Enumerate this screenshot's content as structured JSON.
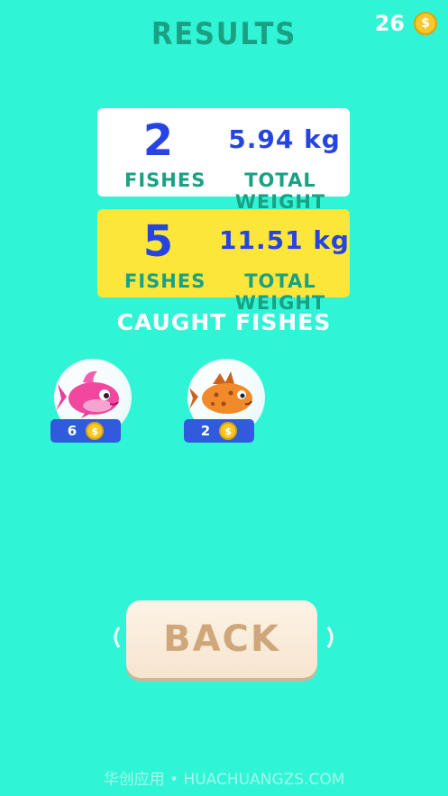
{
  "header": {
    "title": "RESULTS",
    "coin_count": "26"
  },
  "current_result": {
    "fishes": "2",
    "weight": "5.94 kg",
    "fishes_label": "FISHES",
    "weight_label": "TOTAL WEIGHT"
  },
  "best_result": {
    "fishes": "5",
    "weight": "11.51 kg",
    "fishes_label": "FISHES",
    "weight_label": "TOTAL WEIGHT"
  },
  "caught": {
    "title": "CAUGHT FISHES",
    "items": [
      {
        "icon": "pink-fish-icon",
        "value": "6"
      },
      {
        "icon": "orange-spotted-fish-icon",
        "value": "2"
      }
    ]
  },
  "back_button": {
    "label": "BACK"
  },
  "watermark": "华创应用 • HUACHUANGZS.COM",
  "colors": {
    "background": "#2ff5d6",
    "primary_blue": "#2644e0",
    "teal_text": "#1aa184",
    "yellow_card": "#fde63a"
  }
}
